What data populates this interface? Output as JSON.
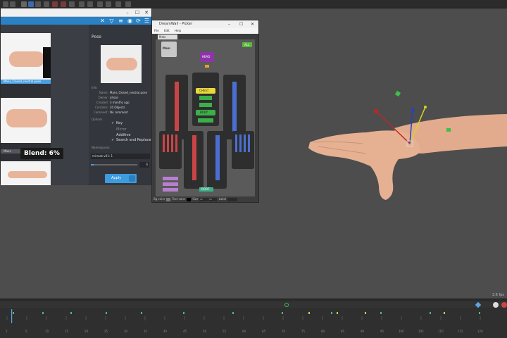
{
  "colors": {
    "accent": "#2a82c6",
    "selection": "#4a9fe0",
    "viewport_bg": "#4d4d4d",
    "skin": "#e8b59a"
  },
  "pose_library": {
    "toolbar_icons": [
      "close-icon",
      "filter-icon",
      "settings-icon",
      "eye-icon",
      "refresh-icon",
      "menu-icon"
    ],
    "thumbnails": [
      {
        "label": "Mans_Closed_neutral.pose",
        "selected": true
      },
      {
        "label": "Mans",
        "selected": false
      },
      {
        "label": "",
        "selected": false
      }
    ],
    "blend_tooltip": "Blend: 6%",
    "blend_value": 0.06,
    "panel_title": "Pose",
    "info_section": "Info",
    "info": {
      "name_key": "Name:",
      "name": "Mans_Closed_neutral.pose",
      "owner_key": "Owner:",
      "owner": "ahsan",
      "created_key": "Created:",
      "created": "3 months ago",
      "contains_key": "Contains:",
      "contains": "20 Objects",
      "comment_key": "Comment:",
      "comment": "No comment"
    },
    "options_section": "Options",
    "options": [
      {
        "label": "Key",
        "checked": true
      },
      {
        "label": "Mirror",
        "checked": false
      },
      {
        "label": "Additive",
        "checked": false
      },
      {
        "label": "Search and Replace",
        "checked": true
      }
    ],
    "namespace_section": "Namespaces",
    "namespace_value": "mirrask-v01: 1",
    "slider_value": "6",
    "apply_label": "Apply"
  },
  "picker": {
    "title": "DreamWall - Picker",
    "menu": [
      "File",
      "Edit",
      "Help"
    ],
    "tab": "Male",
    "main_btn": "Main",
    "all_btn": "ALL",
    "head": "HEAD",
    "chest": "CHEST",
    "body": "BODY",
    "root": "ROOT",
    "footer": {
      "bg_label": "Bg color",
      "text_label": "Text color",
      "size_label": "Size",
      "size_w": "30",
      "size_h": "20",
      "label_label": "Label"
    }
  },
  "viewport": {
    "fps": "3.6 fps"
  },
  "timeline": {
    "tick_labels": [
      "1",
      "5",
      "10",
      "15",
      "20",
      "25",
      "30",
      "35",
      "40",
      "45",
      "50",
      "55",
      "60",
      "65",
      "70",
      "75",
      "80",
      "85",
      "90",
      "95",
      "100",
      "105",
      "110",
      "115",
      "120"
    ]
  }
}
